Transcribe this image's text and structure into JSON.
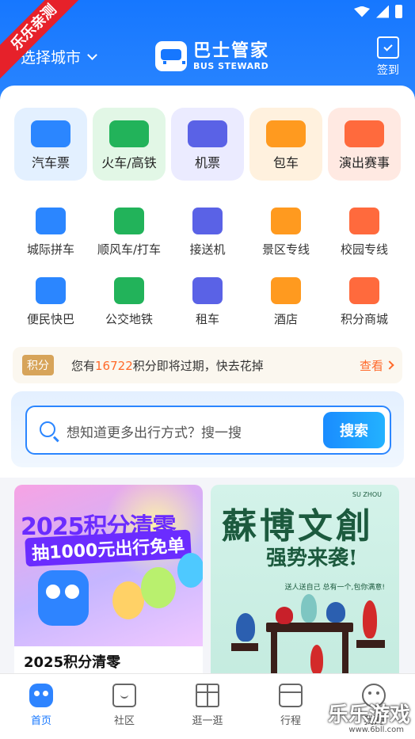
{
  "watermark": {
    "ribbon": "乐乐亲测",
    "brand": "乐乐游戏",
    "url": "www.6bll.com"
  },
  "header": {
    "city": "选择城市",
    "brand_cn": "巴士管家",
    "brand_en": "BUS STEWARD",
    "checkin": "签到"
  },
  "categories": [
    {
      "label": "汽车票",
      "bg": "#e3f0ff",
      "icon": "bus-icon",
      "color": "#2b86ff"
    },
    {
      "label": "火车/高铁",
      "bg": "#e2f7e6",
      "icon": "train-icon",
      "color": "#22b35a"
    },
    {
      "label": "机票",
      "bg": "#ebebff",
      "icon": "plane-icon",
      "color": "#5a62e6"
    },
    {
      "label": "包车",
      "bg": "#fff1de",
      "icon": "charter-bus-icon",
      "color": "#ff9a1f"
    },
    {
      "label": "演出赛事",
      "bg": "#ffe9e2",
      "icon": "music-icon",
      "color": "#ff6a3d"
    }
  ],
  "services_row1": [
    {
      "label": "城际拼车",
      "icon": "carpool-icon",
      "color": "#2b86ff"
    },
    {
      "label": "顺风车/打车",
      "icon": "taxi-icon",
      "color": "#22b35a"
    },
    {
      "label": "接送机",
      "icon": "airport-shuttle-icon",
      "color": "#5a62e6"
    },
    {
      "label": "景区专线",
      "icon": "scenic-gate-icon",
      "color": "#ff9a1f"
    },
    {
      "label": "校园专线",
      "icon": "campus-bus-icon",
      "color": "#ff6a3d"
    }
  ],
  "services_row2": [
    {
      "label": "便民快巴",
      "icon": "express-bus-icon",
      "color": "#2b86ff"
    },
    {
      "label": "公交地铁",
      "icon": "metro-icon",
      "color": "#22b35a"
    },
    {
      "label": "租车",
      "icon": "rental-car-icon",
      "color": "#5a62e6"
    },
    {
      "label": "酒店",
      "icon": "hotel-icon",
      "color": "#ff9a1f"
    },
    {
      "label": "积分商城",
      "icon": "points-mall-icon",
      "color": "#ff6a3d"
    }
  ],
  "points": {
    "tag": "积分",
    "prefix": "您有",
    "amount": "16722",
    "suffix": "积分即将过期，快去花掉",
    "action": "查看"
  },
  "search": {
    "placeholder": "想知道更多出行方式？搜一搜",
    "button": "搜索"
  },
  "cards": [
    {
      "headline": "2025积分清零",
      "sub": "抽1000元出行免单",
      "caption": "2025积分清零"
    },
    {
      "headline": "蘇博文創",
      "sub": "强势来袭!",
      "en": "SU ZHOU",
      "side": "送人送自己 总有一个,包你满意!"
    }
  ],
  "nav": [
    {
      "label": "首页",
      "icon": "home-mascot-icon"
    },
    {
      "label": "社区",
      "icon": "community-icon"
    },
    {
      "label": "逛一逛",
      "icon": "gift-icon"
    },
    {
      "label": "行程",
      "icon": "trip-calendar-icon"
    },
    {
      "label": "我的",
      "icon": "profile-icon"
    }
  ],
  "colors": {
    "primary": "#1677ff",
    "accent_orange": "#ff6a2b",
    "points_tag": "#d7a45a"
  }
}
